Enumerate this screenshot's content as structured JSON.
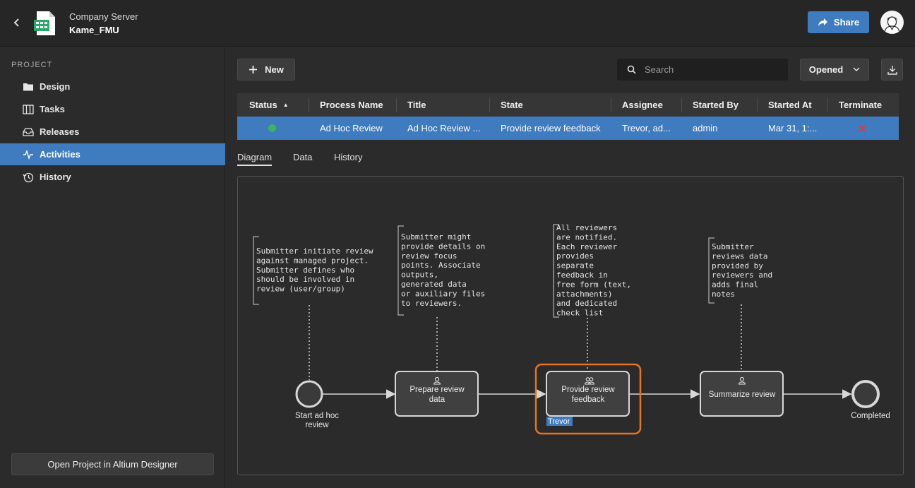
{
  "header": {
    "server": "Company Server",
    "project": "Kame_FMU",
    "share_label": "Share"
  },
  "sidebar": {
    "heading": "PROJECT",
    "items": [
      {
        "label": "Design",
        "icon": "folder-icon"
      },
      {
        "label": "Tasks",
        "icon": "tasks-icon"
      },
      {
        "label": "Releases",
        "icon": "releases-icon"
      },
      {
        "label": "Activities",
        "icon": "activity-icon",
        "active": true
      },
      {
        "label": "History",
        "icon": "history-icon"
      }
    ],
    "open_button": "Open Project in Altium Designer"
  },
  "toolbar": {
    "new_label": "New",
    "search_placeholder": "Search",
    "filter_value": "Opened"
  },
  "table": {
    "columns": [
      "Status",
      "Process Name",
      "Title",
      "State",
      "Assignee",
      "Started By",
      "Started At",
      "Terminate"
    ],
    "sort_indicator": "▲",
    "rows": [
      {
        "status_color": "#3cb55a",
        "process_name": "Ad Hoc Review",
        "title": "Ad Hoc Review ...",
        "state": "Provide review feedback",
        "assignee": "Trevor, ad...",
        "started_by": "admin",
        "started_at": "Mar 31, 1:...",
        "terminate_icon": "close-icon"
      }
    ]
  },
  "tabs": [
    "Diagram",
    "Data",
    "History"
  ],
  "diagram": {
    "notes": [
      {
        "lines": [
          "Submitter initiate review",
          "against managed project.",
          "Submitter defines who",
          "should be involved in",
          "review (user/group)"
        ]
      },
      {
        "lines": [
          "Submitter might",
          "provide details on",
          "review focus",
          "points. Associate",
          "outputs,",
          "generated data",
          "or auxiliary files",
          "to reviewers."
        ]
      },
      {
        "lines": [
          "All reviewers",
          "are notified.",
          "Each reviewer",
          "provides",
          "separate",
          "feedback in",
          "free form (text,",
          "attachments)",
          "and dedicated",
          "check list"
        ]
      },
      {
        "lines": [
          "Submitter",
          "reviews data",
          "provided by",
          "reviewers and",
          "adds final",
          "notes"
        ]
      }
    ],
    "start_event": [
      "Start ad hoc",
      "review"
    ],
    "tasks": [
      {
        "lines": [
          "Prepare review",
          "data"
        ],
        "icon": "user-icon"
      },
      {
        "lines": [
          "Provide review",
          "feedback"
        ],
        "icon": "users-icon",
        "assignee": "Trevor"
      },
      {
        "lines": [
          "Summarize review"
        ],
        "icon": "user-icon"
      }
    ],
    "end_event": "Completed",
    "highlight_color": "#e8731e"
  }
}
